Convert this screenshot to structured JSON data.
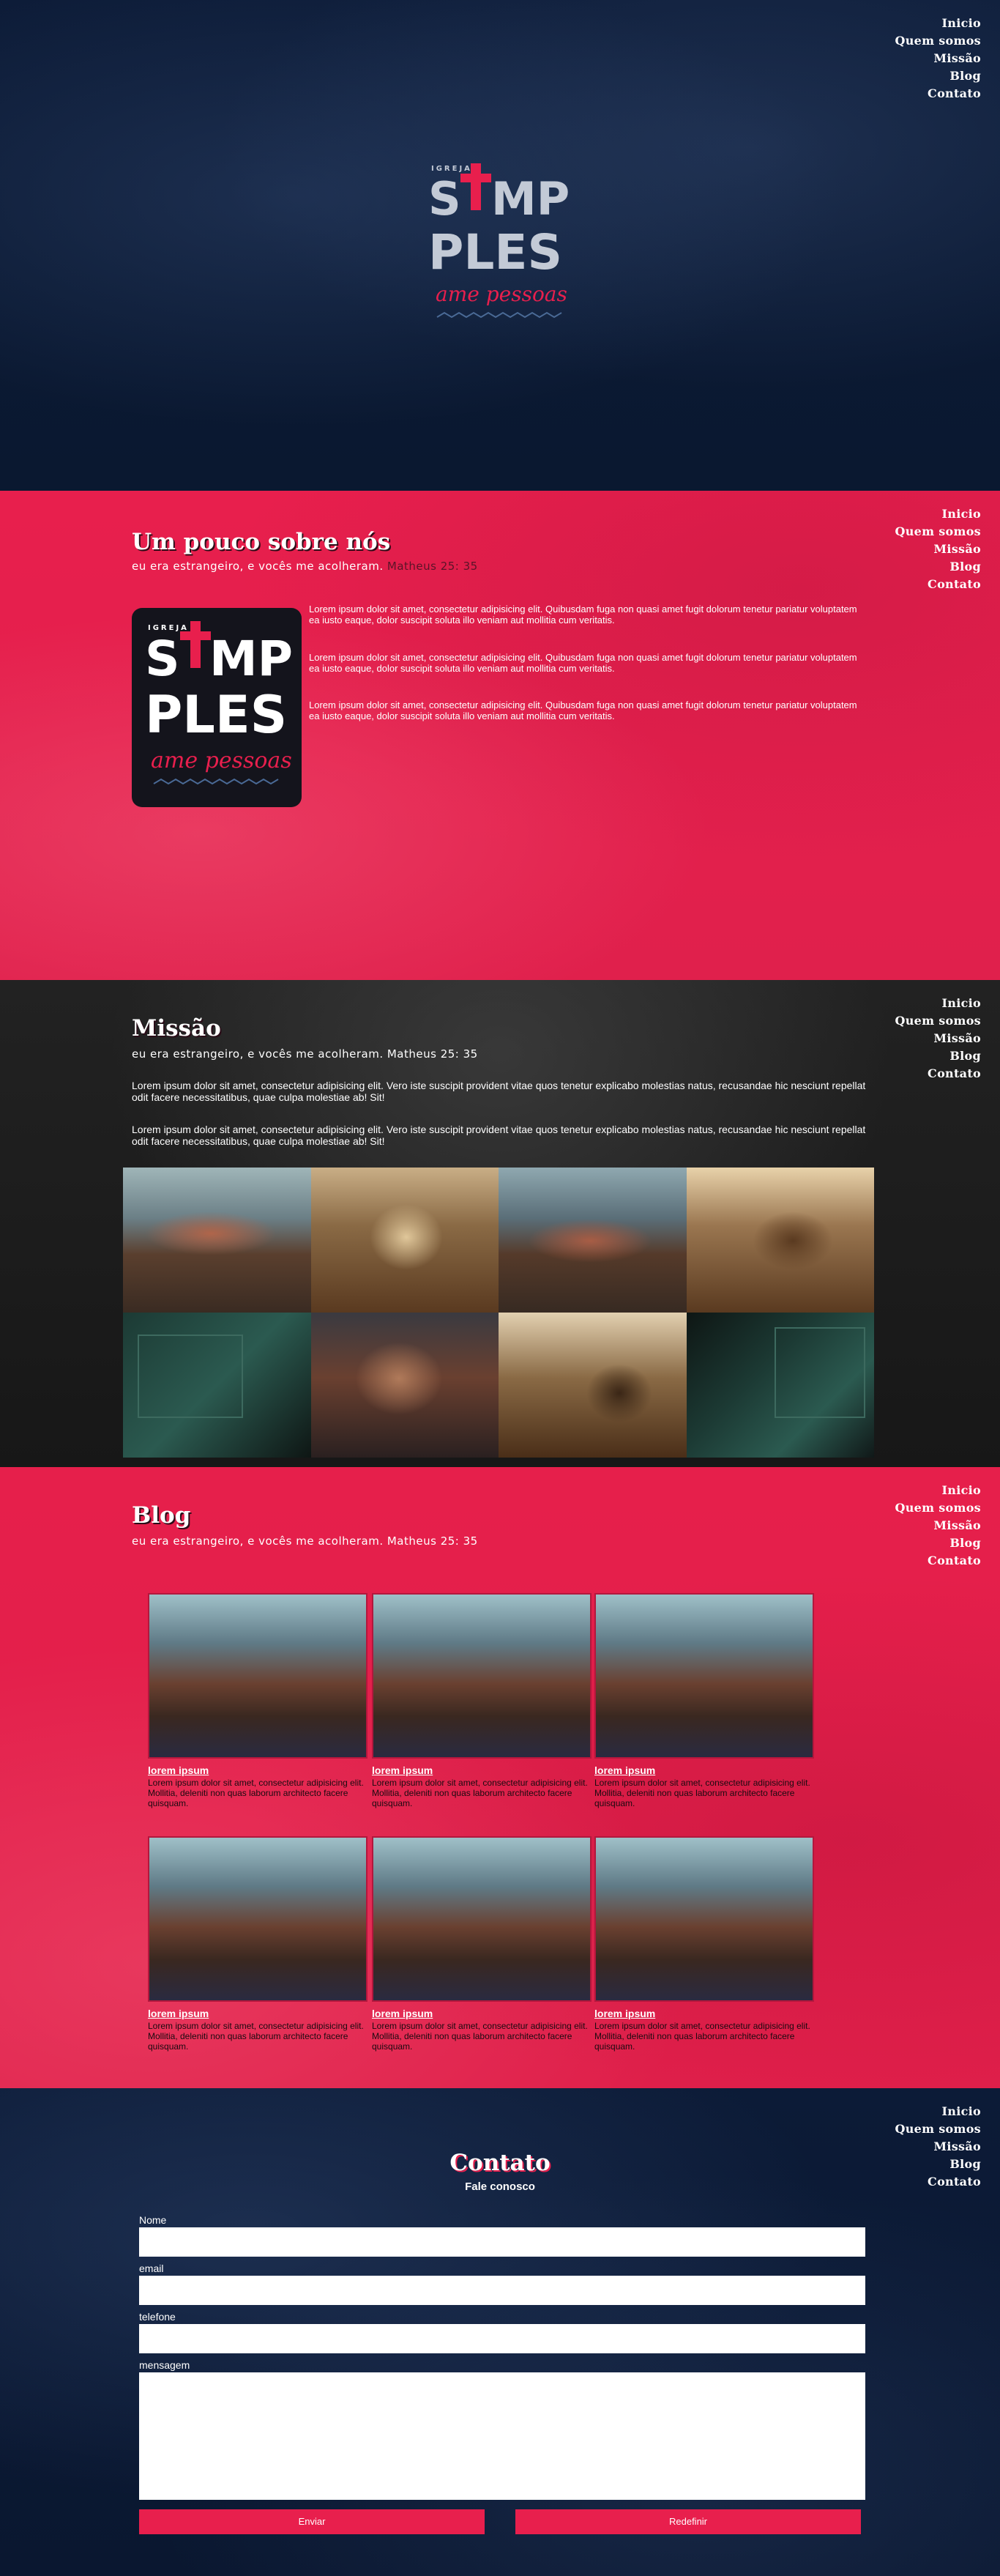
{
  "nav": [
    "Inicio",
    "Quem somos",
    "Missão",
    "Blog",
    "Contato"
  ],
  "logo": {
    "small": "IGREJA",
    "line1": "SIMPLES",
    "line1a": "S",
    "line1b": "MP",
    "line2": "PLES",
    "tagline": "ame pessoas"
  },
  "colors": {
    "brand": "#e81f4d",
    "navy": "#0c1b37",
    "dark": "#1b1b1b",
    "logo_gray": "#c3cad6",
    "logo_cross": "#e81f4d"
  },
  "about": {
    "title": "Um pouco sobre nós",
    "subtitle_a": "eu era estrangeiro, e vocês me acolheram.",
    "subtitle_b": "Matheus 25: 35",
    "paragraphs": [
      "Lorem ipsum dolor sit amet, consectetur adipisicing elit. Quibusdam fuga non quasi amet fugit dolorum tenetur pariatur voluptatem ea iusto eaque, dolor suscipit soluta illo veniam aut mollitia cum veritatis.",
      "Lorem ipsum dolor sit amet, consectetur adipisicing elit. Quibusdam fuga non quasi amet fugit dolorum tenetur pariatur voluptatem ea iusto eaque, dolor suscipit soluta illo veniam aut mollitia cum veritatis.",
      "Lorem ipsum dolor sit amet, consectetur adipisicing elit. Quibusdam fuga non quasi amet fugit dolorum tenetur pariatur voluptatem ea iusto eaque, dolor suscipit soluta illo veniam aut mollitia cum veritatis."
    ]
  },
  "mission": {
    "title": "Missão",
    "subtitle": "eu era estrangeiro, e vocês me acolheram. Matheus 25: 35",
    "paragraphs": [
      "Lorem ipsum dolor sit amet, consectetur adipisicing elit. Vero iste suscipit provident vitae quos tenetur explicabo molestias natus, recusandae hic nesciunt repellat odit facere necessitatibus, quae culpa molestiae ab! Sit!",
      "Lorem ipsum dolor sit amet, consectetur adipisicing elit. Vero iste suscipit provident vitae quos tenetur explicabo molestias natus, recusandae hic nesciunt repellat odit facere necessitatibus, quae culpa molestiae ab! Sit!"
    ],
    "photos": [
      "group-guitar-photo",
      "living-room-photo",
      "group-guitar-photo",
      "living-room-photo",
      "chalkboard-photo",
      "group-guitar-photo",
      "living-room-photo",
      "chalkboard-photo"
    ]
  },
  "blog": {
    "title": "Blog",
    "subtitle": "eu era estrangeiro, e vocês me acolheram. Matheus 25: 35",
    "posts": [
      {
        "title": "lorem ipsum",
        "body": "Lorem ipsum dolor sit amet, consectetur adipisicing elit. Mollitia, deleniti non quas laborum architecto facere quisquam."
      },
      {
        "title": "lorem ipsum",
        "body": "Lorem ipsum dolor sit amet, consectetur adipisicing elit. Mollitia, deleniti non quas laborum architecto facere quisquam."
      },
      {
        "title": "lorem ipsum",
        "body": "Lorem ipsum dolor sit amet, consectetur adipisicing elit. Mollitia, deleniti non quas laborum architecto facere quisquam."
      },
      {
        "title": "lorem ipsum",
        "body": "Lorem ipsum dolor sit amet, consectetur adipisicing elit. Mollitia, deleniti non quas laborum architecto facere quisquam."
      },
      {
        "title": "lorem ipsum",
        "body": "Lorem ipsum dolor sit amet, consectetur adipisicing elit. Mollitia, deleniti non quas laborum architecto facere quisquam."
      },
      {
        "title": "lorem ipsum",
        "body": "Lorem ipsum dolor sit amet, consectetur adipisicing elit. Mollitia, deleniti non quas laborum architecto facere quisquam."
      }
    ]
  },
  "contact": {
    "title": "Contato",
    "subtitle": "Fale conosco",
    "fields": {
      "name": "Nome",
      "email": "email",
      "phone": "telefone",
      "message": "mensagem"
    },
    "submit": "Enviar",
    "reset": "Redefinir"
  }
}
